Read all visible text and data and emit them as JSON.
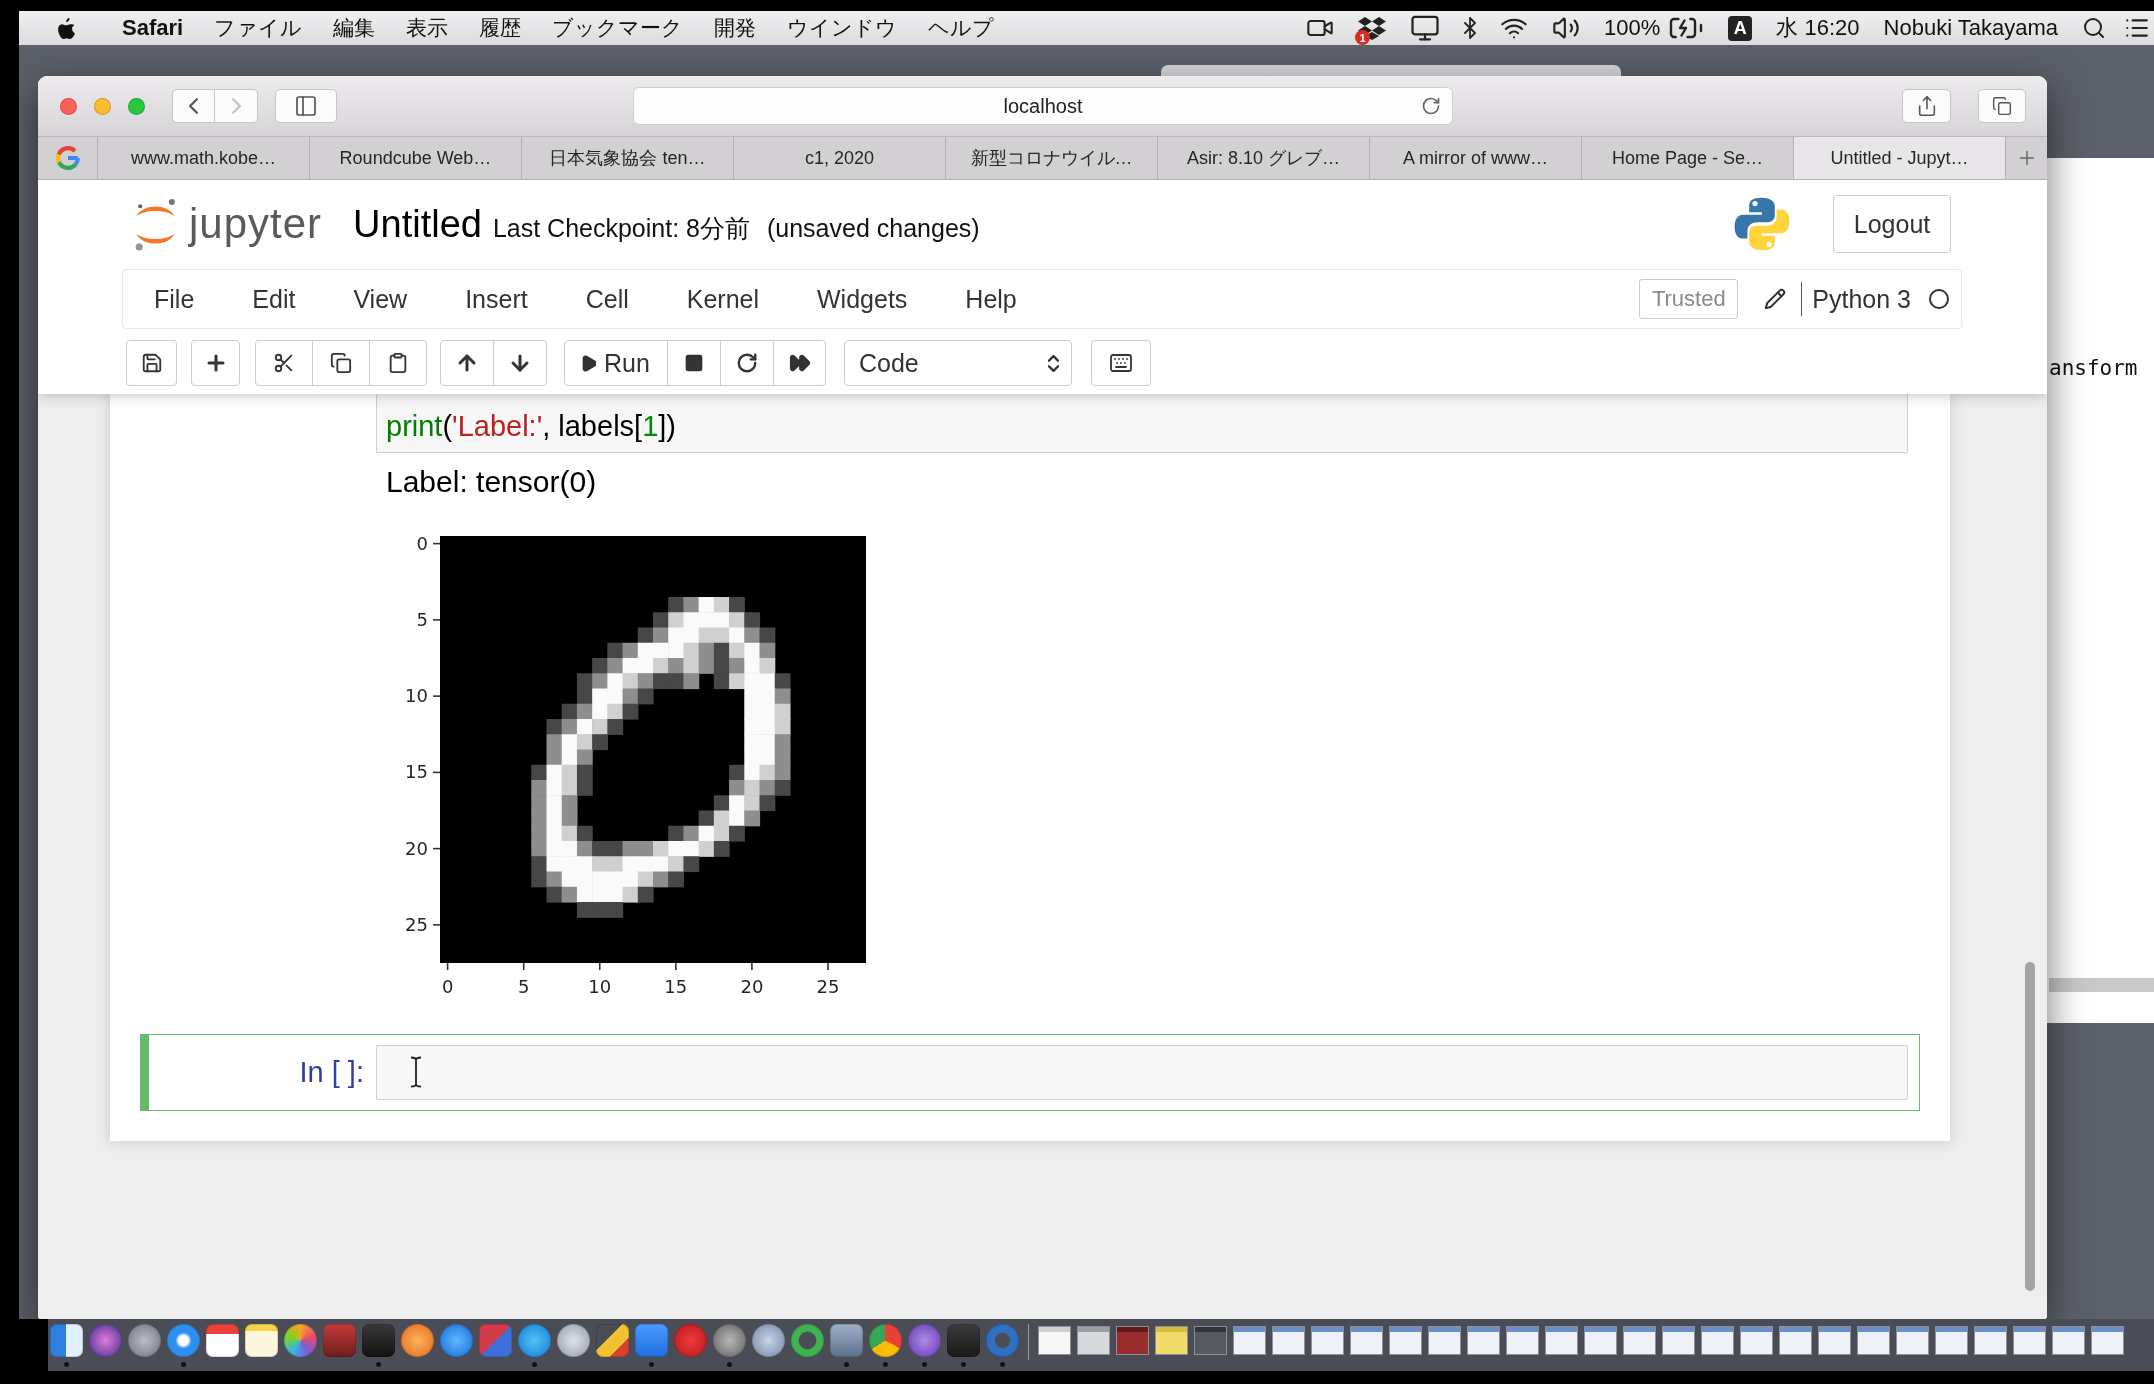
{
  "menu_bar": {
    "app": "Safari",
    "menus": [
      "ファイル",
      "編集",
      "表示",
      "履歴",
      "ブックマーク",
      "開発",
      "ウインドウ",
      "ヘルプ"
    ],
    "badge": "1",
    "battery": "100%",
    "input_source": "A",
    "clock": "水 16:20",
    "user": "Nobuki Takayama"
  },
  "background_window": {
    "text": "ansform"
  },
  "browser": {
    "back_disabled": false,
    "forward_disabled": true,
    "address": "localhost",
    "tabs": [
      {
        "title": "www.math.kobe…",
        "selected": false
      },
      {
        "title": "Roundcube Web…",
        "selected": false
      },
      {
        "title": "日本気象協会 ten…",
        "selected": false
      },
      {
        "title": "c1, 2020",
        "selected": false
      },
      {
        "title": "新型コロナウイル…",
        "selected": false
      },
      {
        "title": "Asir: 8.10 グレブ…",
        "selected": false
      },
      {
        "title": "A mirror of www…",
        "selected": false
      },
      {
        "title": "Home Page - Se…",
        "selected": false
      },
      {
        "title": "Untitled - Jupyt…",
        "selected": true
      }
    ]
  },
  "notebook": {
    "logo": "jupyter",
    "title": "Untitled",
    "checkpoint": "Last Checkpoint: 8分前",
    "save_status": "(unsaved changes)",
    "logout": "Logout",
    "menus": [
      "File",
      "Edit",
      "View",
      "Insert",
      "Cell",
      "Kernel",
      "Widgets",
      "Help"
    ],
    "trusted": "Trusted",
    "kernel": "Python 3",
    "kernel_busy": false,
    "run": "Run",
    "cell_type": "Code",
    "cells": [
      {
        "selected": false,
        "code": [
          {
            "text": "print",
            "kind": "builtin"
          },
          {
            "text": "(",
            "kind": "plain"
          },
          {
            "text": "'Label:'",
            "kind": "string"
          },
          {
            "text": ", labels[",
            "kind": "plain"
          },
          {
            "text": "1",
            "kind": "number"
          },
          {
            "text": "])",
            "kind": "plain"
          }
        ],
        "output": {
          "text": "Label: tensor(0)",
          "y_ticks": [
            "0",
            "5",
            "10",
            "15",
            "20",
            "25"
          ],
          "x_ticks": [
            "0",
            "5",
            "10",
            "15",
            "20",
            "25"
          ]
        }
      },
      {
        "selected": true,
        "prompt": "In [ ]:"
      }
    ]
  },
  "dock": {
    "apps": [
      {
        "running": true
      },
      {
        "running": false
      },
      {
        "running": false
      },
      {
        "running": true
      },
      {
        "running": false
      },
      {
        "running": false
      },
      {
        "running": false
      },
      {
        "running": false
      },
      {
        "running": true
      },
      {
        "running": false
      },
      {
        "running": false
      },
      {
        "running": false
      },
      {
        "running": true
      },
      {
        "running": false
      },
      {
        "running": false
      },
      {
        "running": true
      },
      {
        "running": false
      },
      {
        "running": true
      },
      {
        "running": false
      },
      {
        "running": false
      },
      {
        "running": true
      },
      {
        "running": true
      },
      {
        "running": true
      },
      {
        "running": true
      },
      {
        "running": true
      }
    ]
  }
}
